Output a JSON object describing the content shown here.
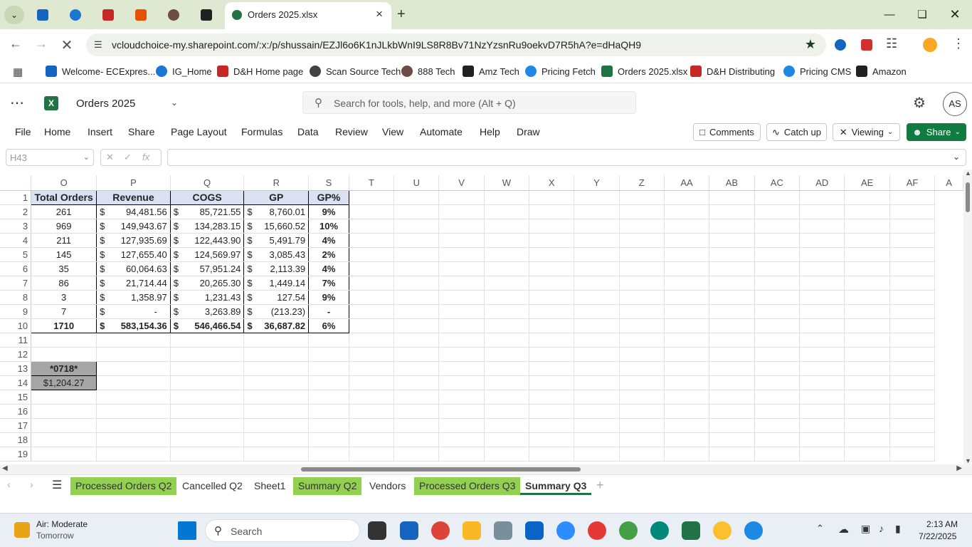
{
  "browser": {
    "active_tab_title": "Orders 2025.xlsx",
    "url": "vcloudchoice-my.sharepoint.com/:x:/p/shussain/EZJl6o6K1nJLkbWnI9LS8R8Bv71NzYzsnRu9oekvD7R5hA?e=dHaQH9",
    "bookmarks": [
      {
        "label": "Welcome- ECExpres...",
        "color": "#1565c0"
      },
      {
        "label": "IG_Home",
        "color": "#1976d2"
      },
      {
        "label": "D&H Home page",
        "color": "#c62828"
      },
      {
        "label": "Scan Source Tech",
        "color": "#424242"
      },
      {
        "label": "888 Tech",
        "color": "#6d4c41"
      },
      {
        "label": "Amz Tech",
        "color": "#212121"
      },
      {
        "label": "Pricing Fetch",
        "color": "#1e88e5"
      },
      {
        "label": "Orders 2025.xlsx",
        "color": "#217346"
      },
      {
        "label": "D&H Distributing",
        "color": "#c62828"
      },
      {
        "label": "Pricing CMS",
        "color": "#1e88e5"
      },
      {
        "label": "Amazon",
        "color": "#212121"
      }
    ]
  },
  "excel": {
    "workbook_name": "Orders 2025",
    "search_placeholder": "Search for tools, help, and more (Alt + Q)",
    "avatar": "AS",
    "menu": [
      "File",
      "Home",
      "Insert",
      "Share",
      "Page Layout",
      "Formulas",
      "Data",
      "Review",
      "View",
      "Automate",
      "Help",
      "Draw"
    ],
    "comments_label": "Comments",
    "catchup_label": "Catch up",
    "viewing_label": "Viewing",
    "share_label": "Share",
    "name_box": "H43",
    "fx_label": "fx",
    "columns": [
      "O",
      "P",
      "Q",
      "R",
      "S",
      "T",
      "U",
      "V",
      "W",
      "X",
      "Y",
      "Z",
      "AA",
      "AB",
      "AC",
      "AD",
      "AE",
      "AF",
      "A"
    ],
    "rows": [
      "1",
      "2",
      "3",
      "4",
      "5",
      "6",
      "7",
      "8",
      "9",
      "10",
      "11",
      "12",
      "13",
      "14",
      "15",
      "16",
      "17",
      "18",
      "19"
    ],
    "headers": [
      "Total Orders",
      "Revenue",
      "COGS",
      "GP",
      "GP%"
    ],
    "data_rows": [
      {
        "orders": "261",
        "revenue": "94,481.56",
        "cogs": "85,721.55",
        "gp": "8,760.01",
        "pct": "9%"
      },
      {
        "orders": "969",
        "revenue": "149,943.67",
        "cogs": "134,283.15",
        "gp": "15,660.52",
        "pct": "10%"
      },
      {
        "orders": "211",
        "revenue": "127,935.69",
        "cogs": "122,443.90",
        "gp": "5,491.79",
        "pct": "4%"
      },
      {
        "orders": "145",
        "revenue": "127,655.40",
        "cogs": "124,569.97",
        "gp": "3,085.43",
        "pct": "2%"
      },
      {
        "orders": "35",
        "revenue": "60,064.63",
        "cogs": "57,951.24",
        "gp": "2,113.39",
        "pct": "4%"
      },
      {
        "orders": "86",
        "revenue": "21,714.44",
        "cogs": "20,265.30",
        "gp": "1,449.14",
        "pct": "7%"
      },
      {
        "orders": "3",
        "revenue": "1,358.97",
        "cogs": "1,231.43",
        "gp": "127.54",
        "pct": "9%"
      },
      {
        "orders": "7",
        "revenue": "-",
        "cogs": "3,263.89",
        "gp": "(213.23)",
        "pct": "-"
      }
    ],
    "total_row": {
      "orders": "1710",
      "revenue": "583,154.36",
      "cogs": "546,466.54",
      "gp": "36,687.82",
      "pct": "6%"
    },
    "currency": "$",
    "note_label": "*0718*",
    "note_value": "$1,204.27",
    "sheets": [
      {
        "label": "Processed Orders Q2",
        "green": true
      },
      {
        "label": "Cancelled Q2",
        "green": false
      },
      {
        "label": "Sheet1",
        "green": false
      },
      {
        "label": "Summary Q2",
        "green": true
      },
      {
        "label": "Vendors",
        "green": false
      },
      {
        "label": "Processed Orders Q3",
        "green": true
      },
      {
        "label": "Summary Q3",
        "green": false,
        "active": true
      }
    ]
  },
  "taskbar": {
    "weather_title": "Air: Moderate",
    "weather_sub": "Tomorrow",
    "search_placeholder": "Search",
    "time": "2:13 AM",
    "date": "7/22/2025"
  }
}
